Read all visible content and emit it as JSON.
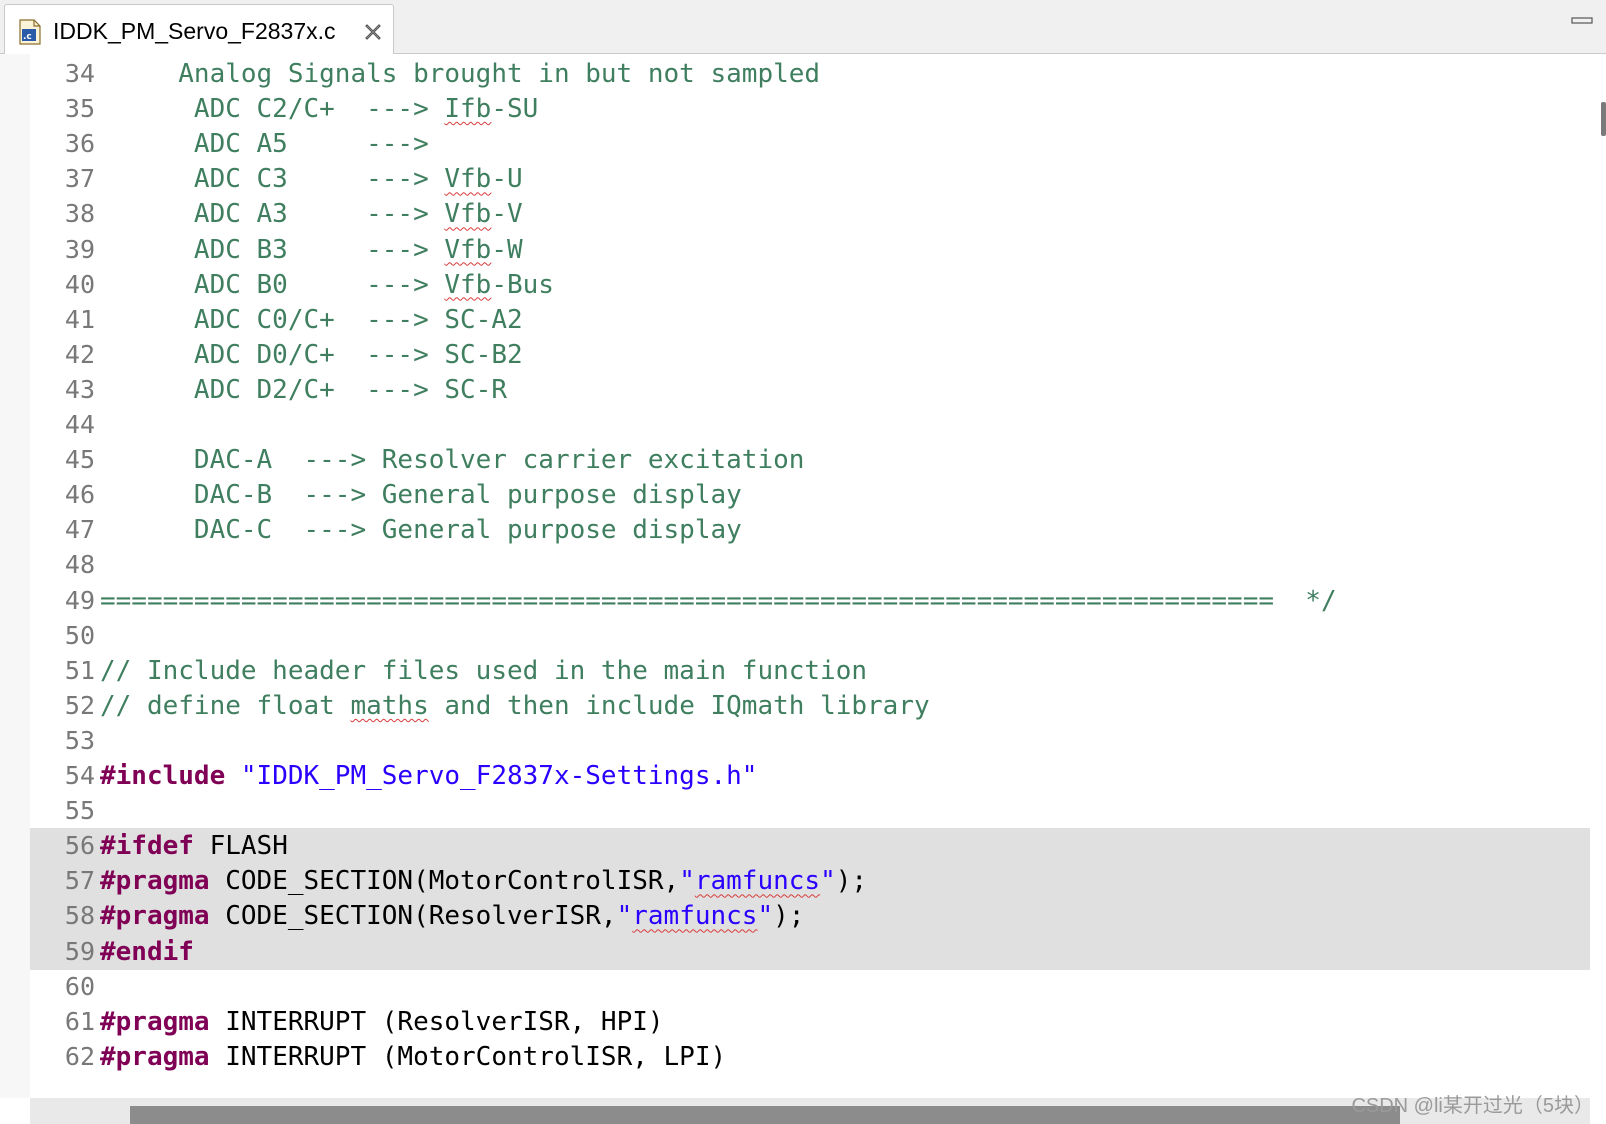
{
  "tab": {
    "title": "IDDK_PM_Servo_F2837x.c",
    "icon_text": ".c"
  },
  "lines": [
    {
      "num": "34",
      "highlight": false,
      "segments": [
        {
          "t": "     Analog Signals brought in but not sampled",
          "c": "c"
        }
      ]
    },
    {
      "num": "35",
      "highlight": false,
      "segments": [
        {
          "t": "      ADC C2/C+  ---> ",
          "c": "c"
        },
        {
          "t": "Ifb",
          "c": "c sq"
        },
        {
          "t": "-SU",
          "c": "c"
        }
      ]
    },
    {
      "num": "36",
      "highlight": false,
      "segments": [
        {
          "t": "      ADC A5     --->",
          "c": "c"
        }
      ]
    },
    {
      "num": "37",
      "highlight": false,
      "segments": [
        {
          "t": "      ADC C3     ---> ",
          "c": "c"
        },
        {
          "t": "Vfb",
          "c": "c sq"
        },
        {
          "t": "-U",
          "c": "c"
        }
      ]
    },
    {
      "num": "38",
      "highlight": false,
      "segments": [
        {
          "t": "      ADC A3     ---> ",
          "c": "c"
        },
        {
          "t": "Vfb",
          "c": "c sq"
        },
        {
          "t": "-V",
          "c": "c"
        }
      ]
    },
    {
      "num": "39",
      "highlight": false,
      "segments": [
        {
          "t": "      ADC B3     ---> ",
          "c": "c"
        },
        {
          "t": "Vfb",
          "c": "c sq"
        },
        {
          "t": "-W",
          "c": "c"
        }
      ]
    },
    {
      "num": "40",
      "highlight": false,
      "segments": [
        {
          "t": "      ADC B0     ---> ",
          "c": "c"
        },
        {
          "t": "Vfb",
          "c": "c sq"
        },
        {
          "t": "-Bus",
          "c": "c"
        }
      ]
    },
    {
      "num": "41",
      "highlight": false,
      "segments": [
        {
          "t": "      ADC C0/C+  ---> SC-A2",
          "c": "c"
        }
      ]
    },
    {
      "num": "42",
      "highlight": false,
      "segments": [
        {
          "t": "      ADC D0/C+  ---> SC-B2",
          "c": "c"
        }
      ]
    },
    {
      "num": "43",
      "highlight": false,
      "segments": [
        {
          "t": "      ADC D2/C+  ---> SC-R",
          "c": "c"
        }
      ]
    },
    {
      "num": "44",
      "highlight": false,
      "segments": []
    },
    {
      "num": "45",
      "highlight": false,
      "segments": [
        {
          "t": "      DAC-A  ---> Resolver carrier excitation",
          "c": "c"
        }
      ]
    },
    {
      "num": "46",
      "highlight": false,
      "segments": [
        {
          "t": "      DAC-B  ---> General purpose display",
          "c": "c"
        }
      ]
    },
    {
      "num": "47",
      "highlight": false,
      "segments": [
        {
          "t": "      DAC-C  ---> General purpose display",
          "c": "c"
        }
      ]
    },
    {
      "num": "48",
      "highlight": false,
      "segments": []
    },
    {
      "num": "49",
      "highlight": false,
      "segments": [
        {
          "t": "===========================================================================  */",
          "c": "c"
        }
      ]
    },
    {
      "num": "50",
      "highlight": false,
      "segments": []
    },
    {
      "num": "51",
      "highlight": false,
      "segments": [
        {
          "t": "// Include header files used in the main function",
          "c": "c"
        }
      ]
    },
    {
      "num": "52",
      "highlight": false,
      "segments": [
        {
          "t": "// define float ",
          "c": "c"
        },
        {
          "t": "maths",
          "c": "c sq"
        },
        {
          "t": " and then include IQmath library",
          "c": "c"
        }
      ]
    },
    {
      "num": "53",
      "highlight": false,
      "segments": []
    },
    {
      "num": "54",
      "highlight": false,
      "segments": [
        {
          "t": "#include",
          "c": "kw"
        },
        {
          "t": " ",
          "c": "p"
        },
        {
          "t": "\"IDDK_PM_Servo_F2837x-Settings.h\"",
          "c": "s"
        }
      ]
    },
    {
      "num": "55",
      "highlight": false,
      "segments": []
    },
    {
      "num": "56",
      "highlight": true,
      "segments": [
        {
          "t": "#ifdef",
          "c": "kw"
        },
        {
          "t": " FLASH",
          "c": "p"
        }
      ]
    },
    {
      "num": "57",
      "highlight": true,
      "segments": [
        {
          "t": "#pragma",
          "c": "kw"
        },
        {
          "t": " CODE_SECTION(MotorControlISR,",
          "c": "p"
        },
        {
          "t": "\"",
          "c": "s"
        },
        {
          "t": "ramfuncs",
          "c": "s sq"
        },
        {
          "t": "\"",
          "c": "s"
        },
        {
          "t": ");",
          "c": "p"
        }
      ]
    },
    {
      "num": "58",
      "highlight": true,
      "segments": [
        {
          "t": "#pragma",
          "c": "kw"
        },
        {
          "t": " CODE_SECTION(ResolverISR,",
          "c": "p"
        },
        {
          "t": "\"",
          "c": "s"
        },
        {
          "t": "ramfuncs",
          "c": "s sq"
        },
        {
          "t": "\"",
          "c": "s"
        },
        {
          "t": ");",
          "c": "p"
        }
      ]
    },
    {
      "num": "59",
      "highlight": true,
      "segments": [
        {
          "t": "#endif",
          "c": "kw"
        }
      ]
    },
    {
      "num": "60",
      "highlight": false,
      "segments": []
    },
    {
      "num": "61",
      "highlight": false,
      "segments": [
        {
          "t": "#pragma",
          "c": "kw"
        },
        {
          "t": " INTERRUPT (ResolverISR, HPI)",
          "c": "p"
        }
      ]
    },
    {
      "num": "62",
      "highlight": false,
      "segments": [
        {
          "t": "#pragma",
          "c": "kw"
        },
        {
          "t": " INTERRUPT (MotorControlISR, LPI)",
          "c": "p"
        }
      ]
    }
  ],
  "watermark": "CSDN @li某开过光（5块）",
  "colors": {
    "comment": "#3f7f5f",
    "keyword": "#7f0055",
    "string": "#2a00ff",
    "line_number": "#787878",
    "highlight_bg": "#e0e0e0",
    "squiggle": "#d83b3b"
  }
}
